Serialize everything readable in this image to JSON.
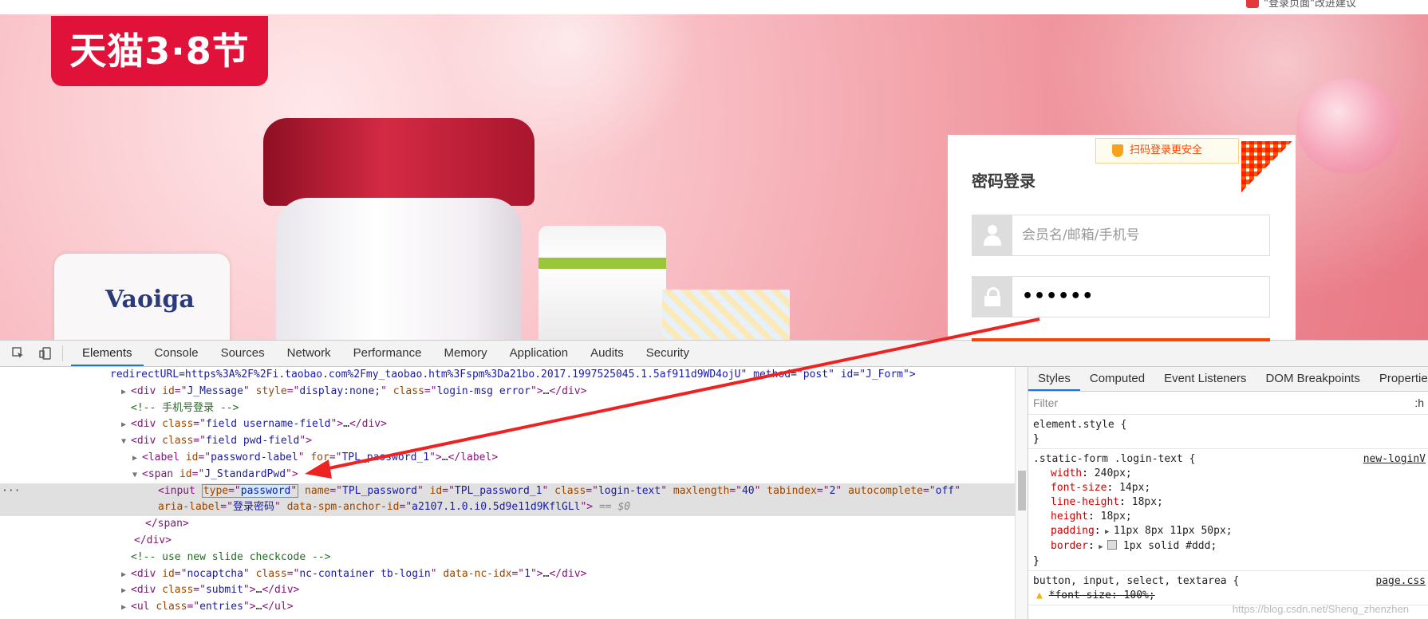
{
  "feedback": {
    "label": "\"登录页面\"改进建议"
  },
  "banner": {
    "logo_text": "天猫3·8节",
    "pack_brand": "Vaoiga"
  },
  "login": {
    "qr_tip": "扫码登录更安全",
    "title": "密码登录",
    "username_placeholder": "会员名/邮箱/手机号",
    "password_value": "••••••"
  },
  "devtools": {
    "tabs": [
      "Elements",
      "Console",
      "Sources",
      "Network",
      "Performance",
      "Memory",
      "Application",
      "Audits",
      "Security"
    ],
    "dom": {
      "l0": "redirectURL=https%3A%2F%2Fi.taobao.com%2Fmy_taobao.htm%3Fspm%3Da21bo.2017.1997525045.1.5af911d9WD4ojU\" method=\"post\" id=\"J_Form\">",
      "l1_id": "J_Message",
      "l1_style": "display:none;",
      "l1_class": "login-msg error",
      "l2_comment": "<!-- 手机号登录 -->",
      "l3_class": "field username-field",
      "l4_class": "field pwd-field",
      "l5_id": "password-label",
      "l5_for": "TPL_password_1",
      "l6_id": "J_StandardPwd",
      "l7_type": "password",
      "l7_name": "TPL_password",
      "l7_id": "TPL_password_1",
      "l7_class": "login-text",
      "l7_maxlength": "40",
      "l7_tabindex": "2",
      "l7_autocomplete": "off",
      "l8_aria": "登录密码",
      "l8_spm": "a2107.1.0.i0.5d9e11d9KflGLl",
      "l8_eq": "== $0",
      "l11_comment": "<!-- use new slide checkcode -->",
      "l12_id": "nocaptcha",
      "l12_class": "nc-container tb-login",
      "l12_idx": "1",
      "l13_class": "submit",
      "l14_class": "entries"
    },
    "styles_tabs": [
      "Styles",
      "Computed",
      "Event Listeners",
      "DOM Breakpoints",
      "Properties"
    ],
    "filter_placeholder": "Filter",
    "filter_hov": ":h",
    "rules": {
      "element_style": "element.style {",
      "r1_selector": ".static-form .login-text {",
      "r1_source": "new-loginV",
      "r1_props": [
        {
          "name": "width",
          "value": "240px;"
        },
        {
          "name": "font-size",
          "value": "14px;"
        },
        {
          "name": "line-height",
          "value": "18px;"
        },
        {
          "name": "height",
          "value": "18px;"
        },
        {
          "name": "padding",
          "value": "11px 8px 11px 50px;"
        },
        {
          "name": "border",
          "value": "1px solid #ddd;"
        }
      ],
      "r2_selector": "button, input, select, textarea {",
      "r2_source": "page.css",
      "r2_prop": "*font-size: 100%;"
    }
  },
  "watermark": "https://blog.csdn.net/Sheng_zhenzhen",
  "colors": {
    "accent": "#1a73e8",
    "taobao_orange": "#ff4400",
    "annotation_arrow": "#ee2222"
  }
}
